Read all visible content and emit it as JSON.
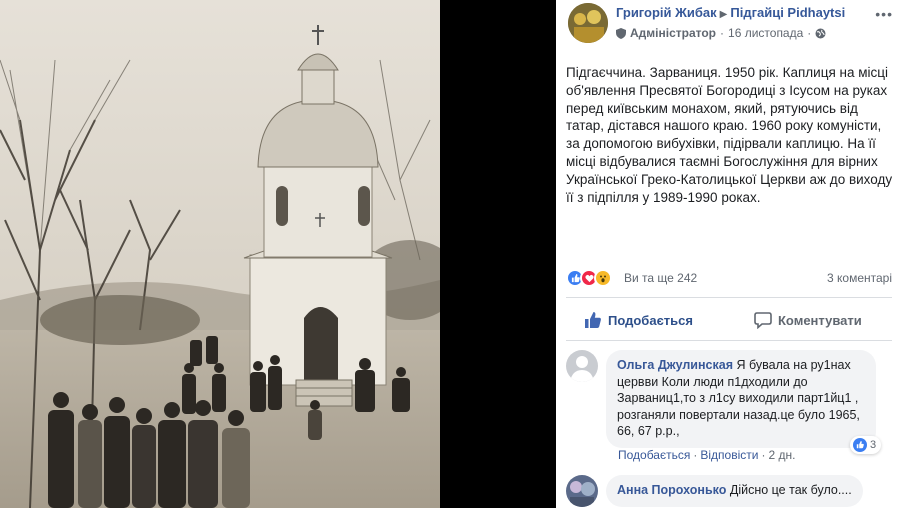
{
  "post": {
    "author": "Григорій Жибак",
    "arrow": "▶",
    "group": "Підгайці Pidhaytsi",
    "role": "Адміністратор",
    "date": "16 листопада",
    "more": "•••",
    "text": "Підгаєччина. Зарваниця. 1950 рік. Каплиця на місці об'явлення Пресвятої Богородиці з Ісусом на руках перед київським монахом, який, рятуючись від татар, дістався нашого краю. 1960 року комуністи, за допомогою вибухівки, підірвали каплицю. На її місці відбувалися таємні Богослужіння для вірних Української Греко-Католицької Церкви аж до виходу її з підпілля у 1989-1990 роках."
  },
  "reactions": {
    "summary": "Ви та ще 242",
    "comments_count": "3 коментарі",
    "icons": [
      "like-icon",
      "love-icon",
      "wow-icon"
    ],
    "colors": {
      "like": "#3b7ef2",
      "love": "#f02849",
      "wow": "#f7b928"
    }
  },
  "actions": {
    "like_label": "Подобається",
    "comment_label": "Коментувати"
  },
  "comments": [
    {
      "name": "Ольга Джулинская",
      "text": "Я бувала на ру1нах цервви Коли люди п1дходили до Зарваниц1,то з л1су виходили парт1йц1 , розганяли повертали назад.це було 1965, 66, 67 р.р.,",
      "like_link": "Подобається",
      "reply_link": "Відповісти",
      "age": "2 дн.",
      "reaction_count": "3"
    },
    {
      "name": "Анна Порохонько",
      "text": "Дійсно це так було...."
    }
  ]
}
